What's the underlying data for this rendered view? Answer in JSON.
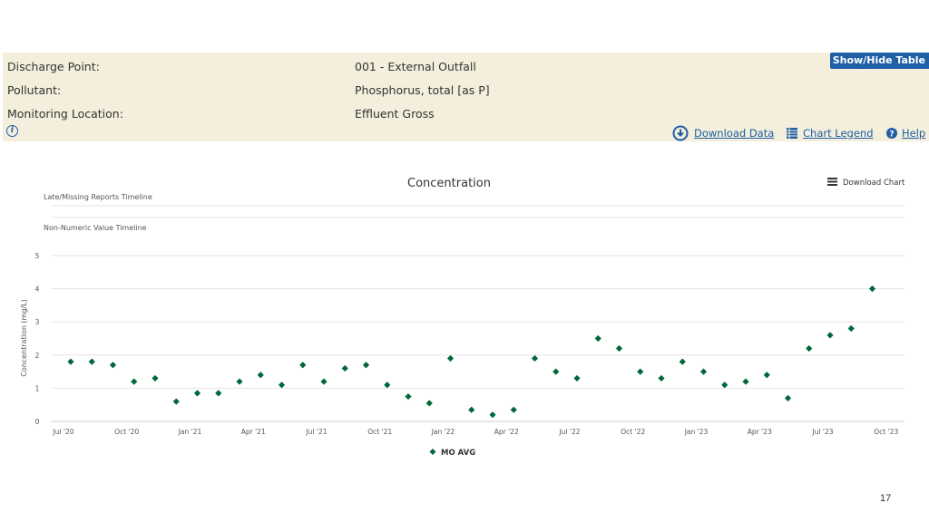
{
  "info": {
    "rows": [
      {
        "label": "Discharge Point:",
        "value": "001 - External Outfall"
      },
      {
        "label": "Pollutant:",
        "value": "Phosphorus, total [as P]"
      },
      {
        "label": "Monitoring Location:",
        "value": "Effluent Gross"
      }
    ],
    "toggle_label": "Show/Hide Table",
    "links": {
      "download_data": "Download Data",
      "chart_legend": "Chart Legend",
      "help": "Help"
    },
    "info_glyph": "i"
  },
  "chart_controls": {
    "download_chart": "Download Chart"
  },
  "timelines": {
    "late_missing": "Late/Missing Reports Timeline",
    "non_numeric": "Non-Numeric Value Timeline"
  },
  "chart_data": {
    "type": "scatter",
    "title": "Concentration",
    "ylabel": "Concentration (mg/L)",
    "ylim": [
      0,
      5
    ],
    "yticks": [
      "0",
      "1",
      "2",
      "3",
      "4",
      "5"
    ],
    "xticks": [
      "Jul '20",
      "Oct '20",
      "Jan '21",
      "Apr '21",
      "Jul '21",
      "Oct '21",
      "Jan '22",
      "Apr '22",
      "Jul '22",
      "Oct '22",
      "Jan '23",
      "Apr '23",
      "Jul '23",
      "Oct '23"
    ],
    "grid": true,
    "legend_position": "bottom-center",
    "series": [
      {
        "name": "MO AVG",
        "color": "#006837",
        "marker": "diamond",
        "x": [
          "2020-07",
          "2020-08",
          "2020-09",
          "2020-10",
          "2020-11",
          "2020-12",
          "2021-01",
          "2021-02",
          "2021-03",
          "2021-04",
          "2021-05",
          "2021-06",
          "2021-07",
          "2021-08",
          "2021-09",
          "2021-10",
          "2021-11",
          "2021-12",
          "2022-01",
          "2022-02",
          "2022-03",
          "2022-04",
          "2022-05",
          "2022-06",
          "2022-07",
          "2022-08",
          "2022-09",
          "2022-10",
          "2022-11",
          "2022-12",
          "2023-01",
          "2023-02",
          "2023-03",
          "2023-04",
          "2023-05",
          "2023-06",
          "2023-07",
          "2023-08",
          "2023-09"
        ],
        "y": [
          1.8,
          1.8,
          1.7,
          1.2,
          1.3,
          0.6,
          0.85,
          0.85,
          1.2,
          1.4,
          1.1,
          1.7,
          1.2,
          1.6,
          1.7,
          1.1,
          0.75,
          0.55,
          1.9,
          0.35,
          0.2,
          0.35,
          1.9,
          1.5,
          1.3,
          2.5,
          2.2,
          1.5,
          1.3,
          1.8,
          1.5,
          1.1,
          1.2,
          1.4,
          0.7,
          2.2,
          2.6,
          2.8,
          4.0
        ]
      }
    ]
  },
  "page_number": "17",
  "colors": {
    "panel_bg": "#f3efdc",
    "link": "#1f5fa6",
    "marker": "#006837"
  },
  "icons": {
    "info": "info-icon",
    "download": "download-circle-icon",
    "legend": "table-list-icon",
    "help": "help-circle-icon",
    "menu": "hamburger-menu-icon"
  }
}
